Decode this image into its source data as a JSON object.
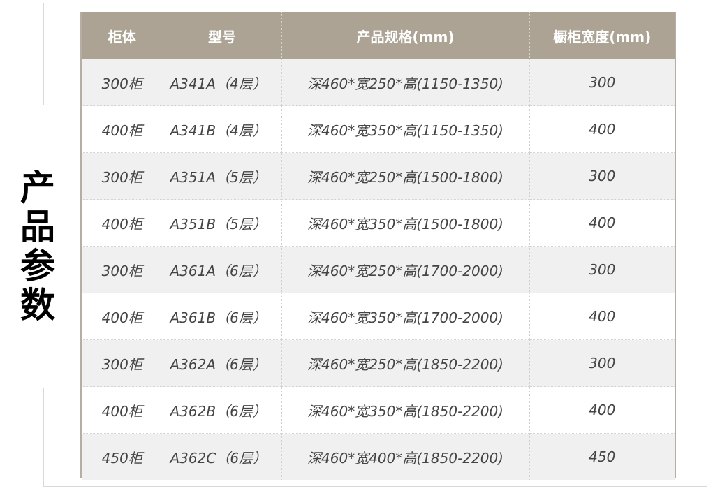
{
  "side_title": [
    "产",
    "品",
    "参",
    "数"
  ],
  "table": {
    "headers": [
      "柜体",
      "型号",
      "产品规格(mm)",
      "橱柜宽度(mm)"
    ],
    "rows": [
      [
        "300柜",
        "A341A（4层）",
        "深460*宽250*高(1150-1350)",
        "300"
      ],
      [
        "400柜",
        "A341B（4层）",
        "深460*宽350*高(1150-1350)",
        "400"
      ],
      [
        "300柜",
        "A351A（5层）",
        "深460*宽250*高(1500-1800)",
        "300"
      ],
      [
        "400柜",
        "A351B（5层）",
        "深460*宽350*高(1500-1800)",
        "400"
      ],
      [
        "300柜",
        "A361A（6层）",
        "深460*宽250*高(1700-2000)",
        "300"
      ],
      [
        "400柜",
        "A361B（6层）",
        "深460*宽350*高(1700-2000)",
        "400"
      ],
      [
        "300柜",
        "A362A（6层）",
        "深460*宽250*高(1850-2200)",
        "300"
      ],
      [
        "400柜",
        "A362B（6层）",
        "深460*宽350*高(1850-2200)",
        "400"
      ],
      [
        "450柜",
        "A362C（6层）",
        "深460*宽400*高(1850-2200)",
        "450"
      ]
    ]
  },
  "colors": {
    "header_bg": "#aca394",
    "header_text": "#ffffff",
    "row_alt_bg": "#f0f0f0",
    "border": "#b6aea2"
  }
}
